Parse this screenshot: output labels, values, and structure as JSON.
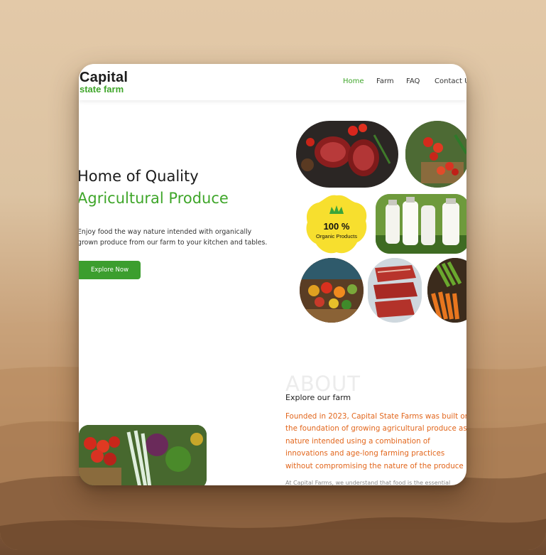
{
  "brand": {
    "line1": "Capital",
    "line2": "state farm"
  },
  "nav": {
    "items": [
      "Home",
      "Farm",
      "FAQ",
      "Contact U"
    ],
    "active": "Home"
  },
  "hero": {
    "title_line1": "Home of Quality",
    "title_line2": "Agricultural Produce",
    "lede_line1": "Enjoy food the way nature intended with organically",
    "lede_line2": "grown produce from our farm to your kitchen and tables.",
    "button": "Explore Now"
  },
  "badge": {
    "percent": "100 %",
    "label": "Organic Products"
  },
  "gallery": {
    "icons": [
      "steak-photo",
      "tomato-basket-photo",
      "milk-bottles-photo",
      "market-stall-photo",
      "raw-meat-photo",
      "carrots-peppers-photo",
      "vegetable-basket-photo"
    ]
  },
  "about": {
    "ghost_title": "ABOUT",
    "subtitle": "Explore our farm",
    "body": "Founded in 2023, Capital State Farms was built on the foundation of growing agricultural produce as nature intended using a combination of innovations and age-long farming practices without compromising the nature of the produce",
    "cut_line": "At Capital Farms, we understand that food is the essential"
  },
  "colors": {
    "accent": "#3fa62a",
    "button": "#3c9e2e",
    "about_text": "#e2661c",
    "badge": "#f7df2e"
  }
}
